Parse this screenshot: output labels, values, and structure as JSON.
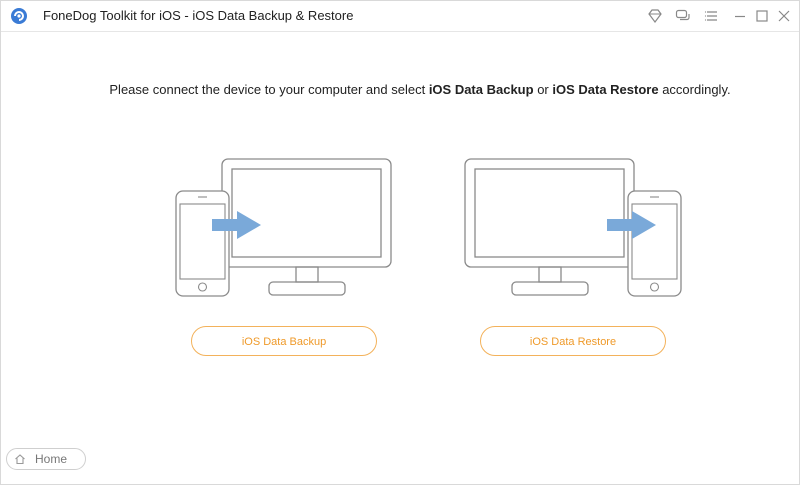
{
  "window": {
    "title": "FoneDog Toolkit for iOS - iOS Data Backup & Restore"
  },
  "titlebar_icons": [
    "diamond-icon",
    "feedback-icon",
    "menu-icon",
    "minimize-icon",
    "maximize-icon",
    "close-icon"
  ],
  "instruction": {
    "prefix": "Please connect the device to your computer and select ",
    "option_backup": "iOS Data Backup",
    "middle": " or ",
    "option_restore": "iOS Data Restore",
    "suffix": " accordingly."
  },
  "buttons": {
    "backup_label": "iOS Data Backup",
    "restore_label": "iOS Data Restore"
  },
  "home": {
    "label": "Home"
  },
  "colors": {
    "accent_orange": "#ef9a2a",
    "arrow_blue": "#7aa9d9",
    "device_outline": "#8a8a8a"
  }
}
